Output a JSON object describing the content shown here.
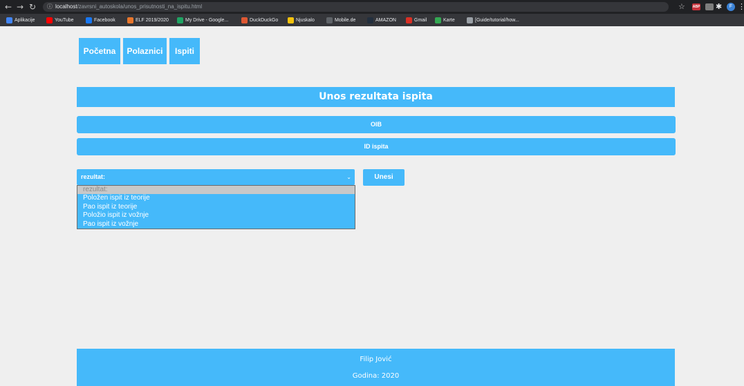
{
  "browser": {
    "url_host": "localhost",
    "url_path": "/zavrsni_autoskola/unos_prisutnosti_na_ispitu.html",
    "abp_label": "ABP",
    "profile_initial": "F",
    "bookmarks": [
      {
        "label": "Aplikacije",
        "color": "#4285f4"
      },
      {
        "label": "YouTube",
        "color": "#ff0000"
      },
      {
        "label": "Facebook",
        "color": "#1877f2"
      },
      {
        "label": "ELF 2019/2020",
        "color": "#e8762c"
      },
      {
        "label": "My Drive - Google...",
        "color": "#1fa463"
      },
      {
        "label": "DuckDuckGo",
        "color": "#de5833"
      },
      {
        "label": "Njuskalo",
        "color": "#f4c20d"
      },
      {
        "label": "Mobile.de",
        "color": "#5f6368"
      },
      {
        "label": "AMAZON",
        "color": "#232f3e"
      },
      {
        "label": "Gmail",
        "color": "#d93025"
      },
      {
        "label": "Karte",
        "color": "#34a853"
      },
      {
        "label": "[Guide/tutorial/how...",
        "color": "#9aa0a6"
      }
    ]
  },
  "nav": {
    "items": [
      "Početna",
      "Polaznici",
      "Ispiti"
    ]
  },
  "page": {
    "title": "Unos rezultata ispita",
    "oib_label": "OIB",
    "id_label": "ID ispita",
    "select_value": "rezultat:",
    "options": [
      "rezultat:",
      "Položen ispit iz teorije",
      "Pao ispit iz teorije",
      "Položio ispit iz vožnje",
      "Pao ispit iz vožnje"
    ],
    "submit_label": "Unesi"
  },
  "footer": {
    "name": "Filip Jović",
    "year": "Godina: 2020"
  },
  "colors": {
    "accent": "#45b9fa",
    "background": "#efefef"
  }
}
